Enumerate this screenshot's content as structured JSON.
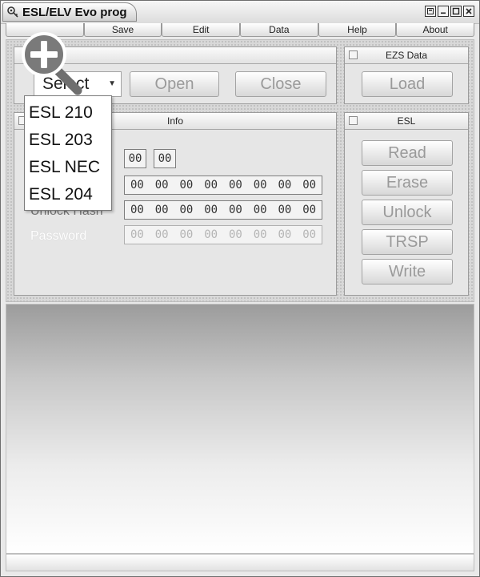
{
  "window": {
    "title": "ESL/ELV Evo prog"
  },
  "menu": [
    "",
    "Save",
    "Edit",
    "Data",
    "Help",
    "About"
  ],
  "esl_panel_main": {
    "select_value": "Select",
    "open_label": "Open",
    "close_label": "Close"
  },
  "ezs_panel": {
    "title": "EZS Data",
    "load_label": "Load"
  },
  "info_panel": {
    "title": "Info",
    "rows": [
      {
        "label": "",
        "bytes": [
          "00",
          "00"
        ]
      },
      {
        "label": "",
        "bytes": [
          "00",
          "00",
          "00",
          "00",
          "00",
          "00",
          "00",
          "00"
        ]
      },
      {
        "label": "Unlock Hash",
        "bytes": [
          "00",
          "00",
          "00",
          "00",
          "00",
          "00",
          "00",
          "00"
        ]
      },
      {
        "label": "Password",
        "bytes": [
          "00",
          "00",
          "00",
          "00",
          "00",
          "00",
          "00",
          "00"
        ]
      }
    ]
  },
  "esl_panel": {
    "title": "ESL",
    "buttons": [
      "Read",
      "Erase",
      "Unlock",
      "TRSP",
      "Write"
    ]
  },
  "dropdown": {
    "options": [
      "ESL 210",
      "ESL 203",
      "ESL NEC",
      "ESL 204"
    ]
  },
  "icons": {
    "app": "car-key-icon",
    "zoom": "zoom-in-icon"
  }
}
